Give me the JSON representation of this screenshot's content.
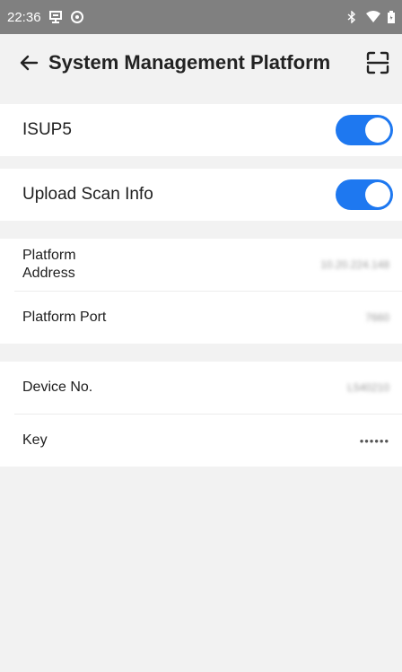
{
  "status_bar": {
    "time": "22:36"
  },
  "app_bar": {
    "title": "System Management Platform"
  },
  "settings": {
    "isup5": {
      "label": "ISUP5",
      "enabled": true
    },
    "upload_scan_info": {
      "label": "Upload Scan Info",
      "enabled": true
    },
    "platform_address": {
      "label_line1": "Platform",
      "label_line2": "Address",
      "value": "10.20.224.148"
    },
    "platform_port": {
      "label": "Platform Port",
      "value": "7660"
    },
    "device_no": {
      "label": "Device No.",
      "value": "L540210"
    },
    "key": {
      "label": "Key",
      "value": "••••••"
    }
  },
  "colors": {
    "accent": "#1e78f0",
    "status_bar": "#808080",
    "background": "#f2f2f2"
  }
}
